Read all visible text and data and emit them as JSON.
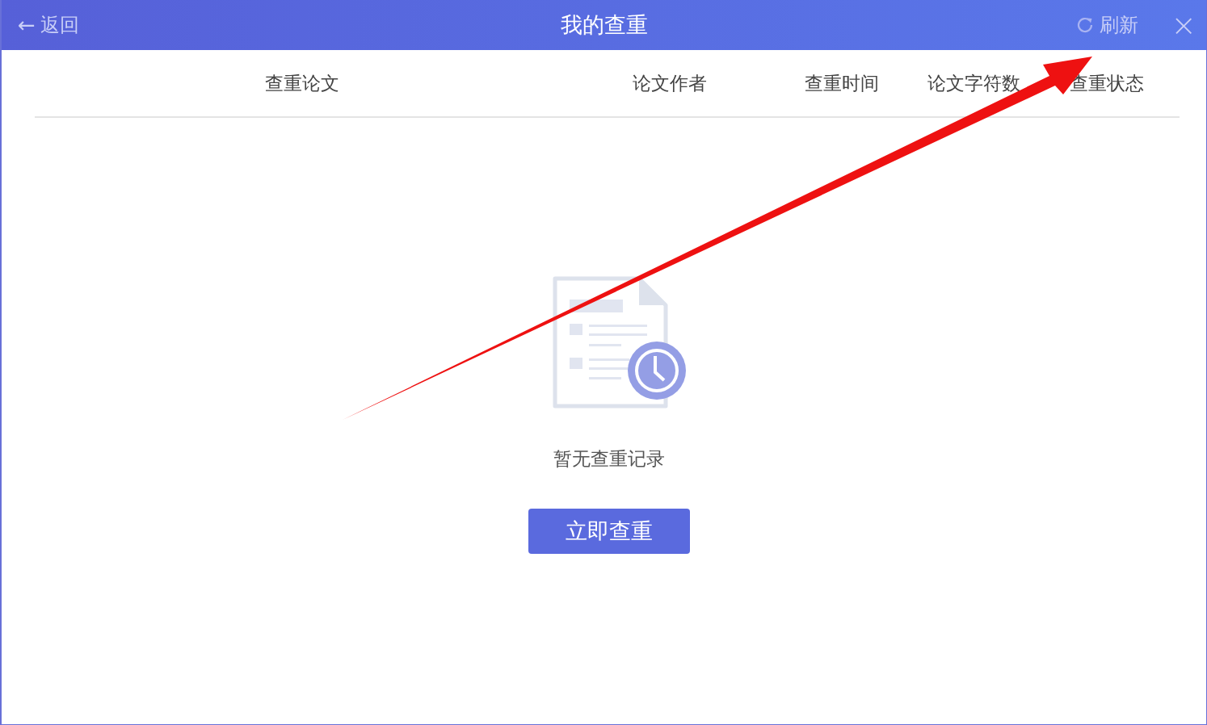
{
  "header": {
    "back": {
      "icon": "←",
      "label": "返回"
    },
    "title": "我的查重",
    "refresh": "刷新",
    "close": "×"
  },
  "table": {
    "columns": [
      "查重论文",
      "论文作者",
      "查重时间",
      "论文字符数",
      "查重状态"
    ]
  },
  "empty_state": {
    "message": "暂无查重记录",
    "button": "立即查重"
  },
  "annotation": {
    "kind": "arrow"
  }
}
